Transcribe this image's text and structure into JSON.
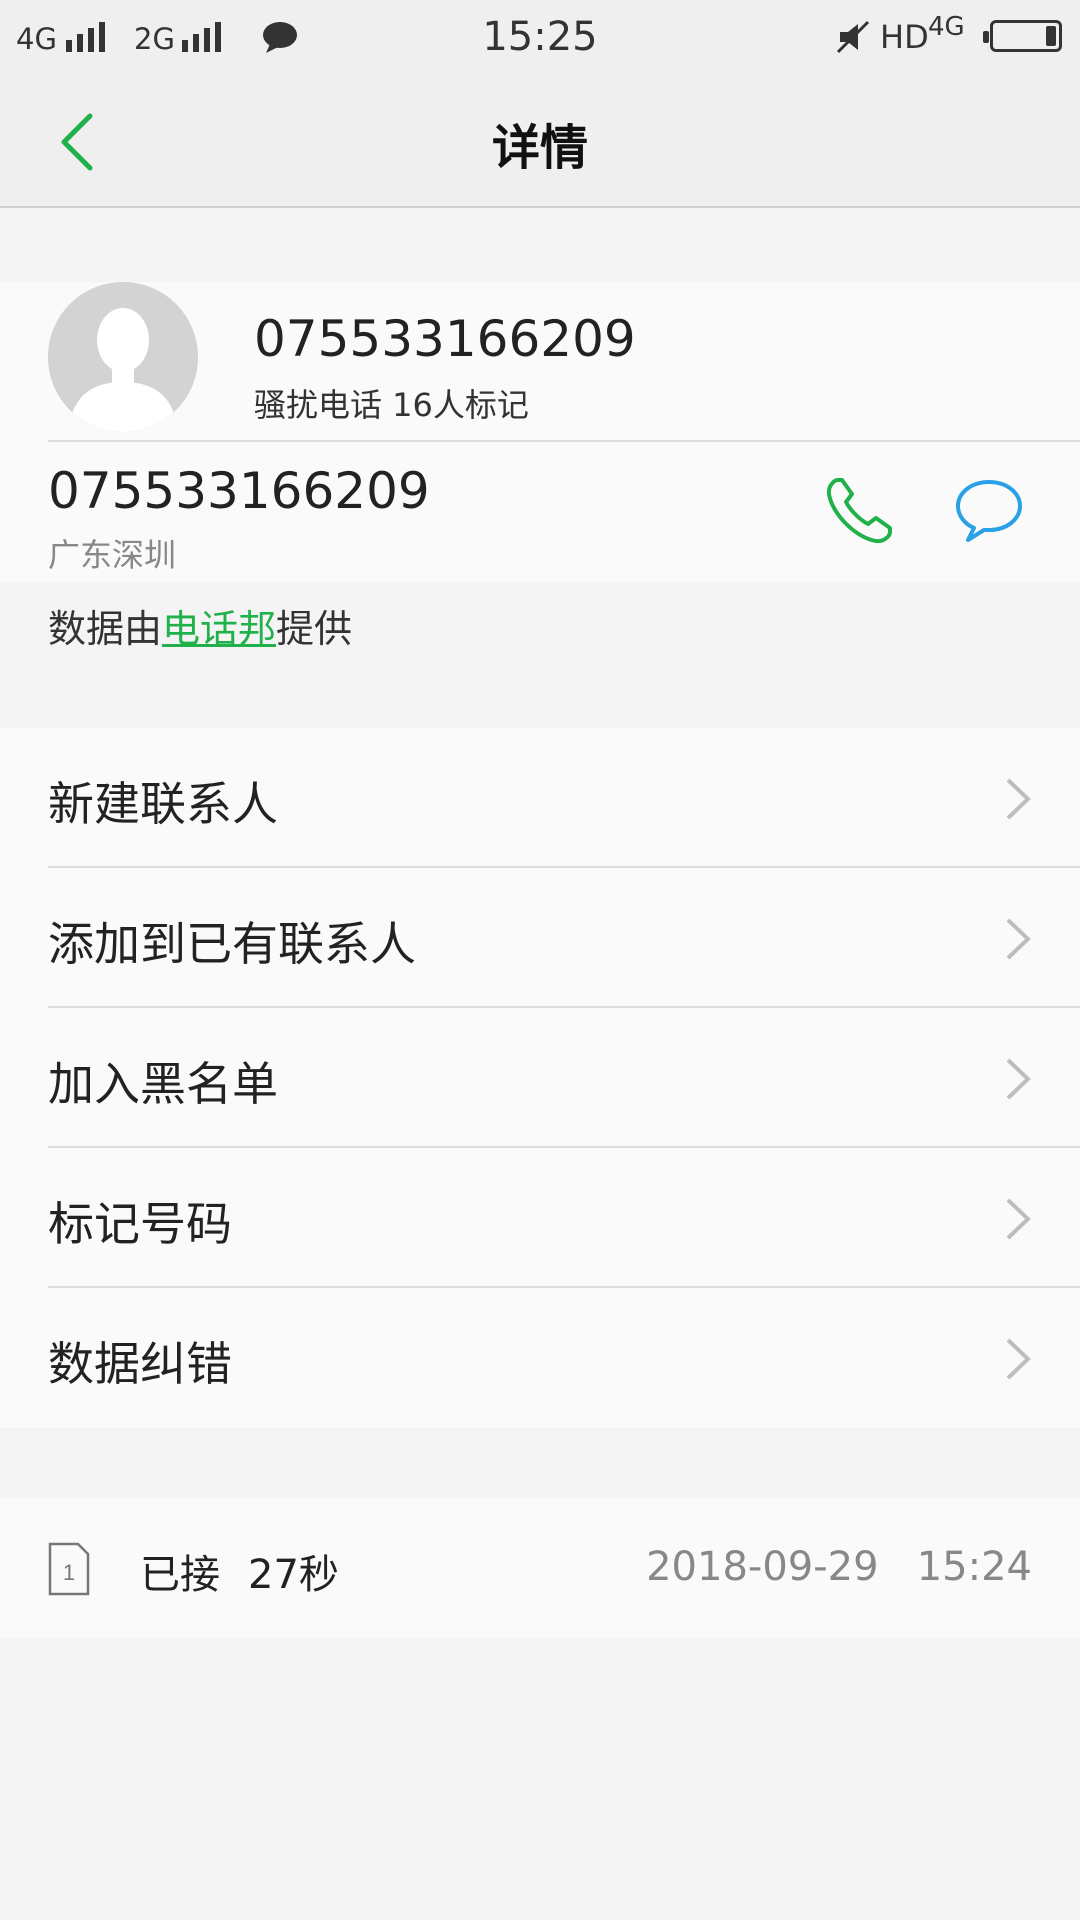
{
  "status_bar": {
    "net1": "4G",
    "net2": "2G",
    "time": "15:25",
    "hd": "HD",
    "lte": "4G"
  },
  "header": {
    "title": "详情"
  },
  "profile": {
    "number_title": "075533166209",
    "tag": "骚扰电话 16人标记",
    "phone_number": "075533166209",
    "location": "广东深圳"
  },
  "provider": {
    "prefix": "数据由",
    "link": "电话邦",
    "suffix": "提供"
  },
  "menu": {
    "items": [
      {
        "label": "新建联系人"
      },
      {
        "label": "添加到已有联系人"
      },
      {
        "label": "加入黑名单"
      },
      {
        "label": "标记号码"
      },
      {
        "label": "数据纠错"
      }
    ]
  },
  "record": {
    "sim": "1",
    "status": "已接",
    "duration": "27秒",
    "datetime": "2018-09-29   15:24"
  },
  "colors": {
    "accent_green": "#21b14a",
    "message_blue": "#2aa0e6"
  }
}
